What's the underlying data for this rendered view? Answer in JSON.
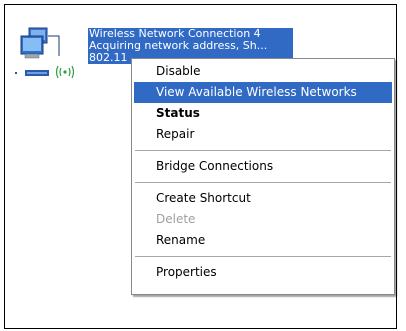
{
  "connection": {
    "name": "Wireless Network Connection 4",
    "status": "Acquiring network address, Sh...",
    "device": "802.11",
    "icon": "wireless-network-connection-icon"
  },
  "menu": {
    "items": [
      {
        "label": "Disable"
      },
      {
        "label": "View Available Wireless Networks"
      },
      {
        "label": "Status"
      },
      {
        "label": "Repair"
      },
      {
        "label": "Bridge Connections"
      },
      {
        "label": "Create Shortcut"
      },
      {
        "label": "Delete"
      },
      {
        "label": "Rename"
      },
      {
        "label": "Properties"
      }
    ]
  },
  "colors": {
    "selection": "#316ac5",
    "disabled_text": "#a0a0a0"
  }
}
